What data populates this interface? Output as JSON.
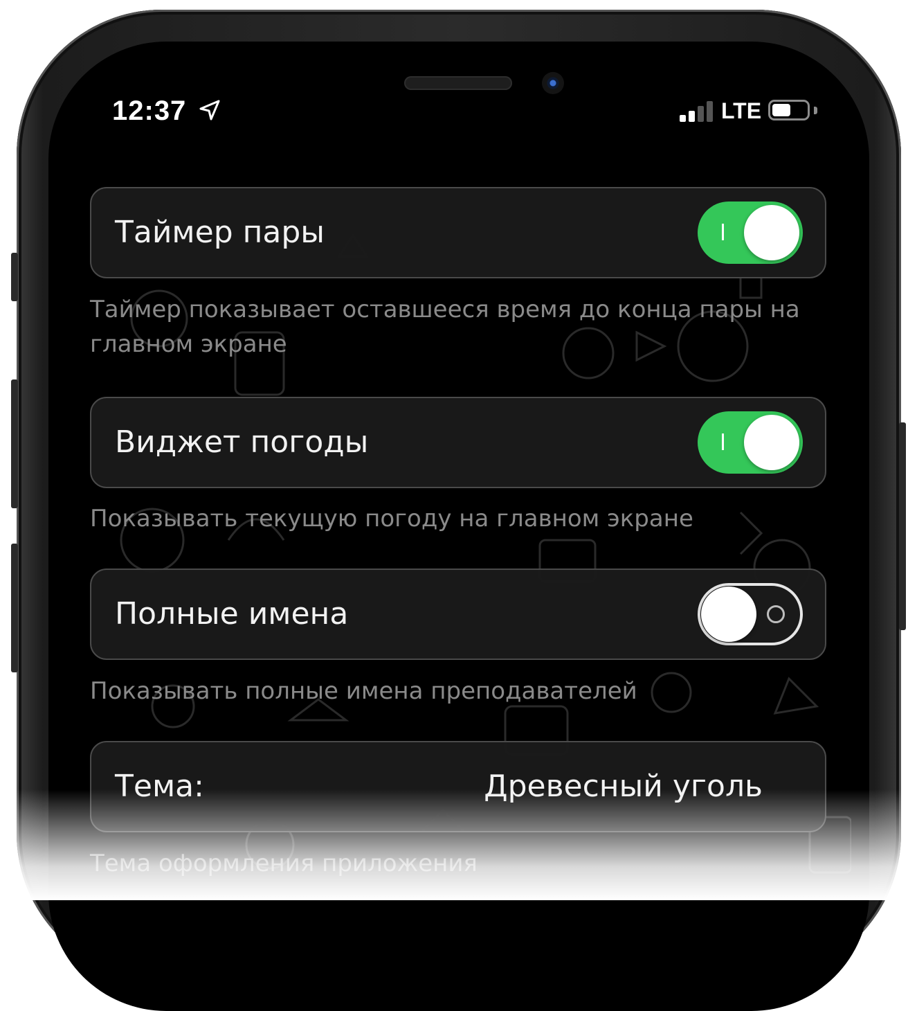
{
  "status_bar": {
    "time": "12:37",
    "network": "LTE",
    "location_icon": "location-arrow-icon",
    "signal_bars_active": 2,
    "signal_bars_total": 4,
    "battery_level": 0.55
  },
  "settings": [
    {
      "label": "Таймер пары",
      "toggle": true,
      "description": "Таймер показывает оставшееся время до конца пары на главном экране"
    },
    {
      "label": "Виджет погоды",
      "toggle": true,
      "description": "Показывать текущую погоду на главном экране"
    },
    {
      "label": "Полные имена",
      "toggle": false,
      "description": "Показывать полные имена преподавателей"
    },
    {
      "label": "Тема:",
      "value": "Древесный уголь",
      "description": "Тема оформления приложения"
    }
  ],
  "colors": {
    "toggle_on": "#34c759",
    "card_background": "#1a1a1a",
    "description_text": "#8a8a8a"
  }
}
